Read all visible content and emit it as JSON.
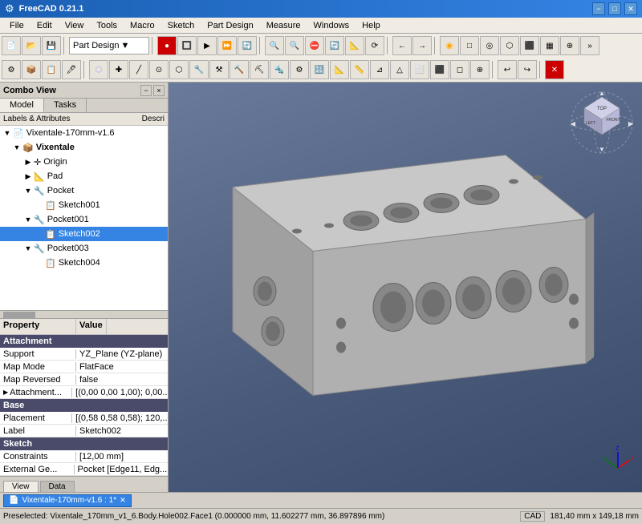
{
  "titlebar": {
    "title": "FreeCAD 0.21.1",
    "icon": "⚙"
  },
  "menubar": {
    "items": [
      "File",
      "Edit",
      "View",
      "Tools",
      "Macro",
      "Sketch",
      "Part Design",
      "Measure",
      "Windows",
      "Help"
    ]
  },
  "toolbar": {
    "workbench_label": "Part Design",
    "workbench_arrow": "▼"
  },
  "combo": {
    "title": "Combo View",
    "minimize_label": "−",
    "close_label": "×",
    "tabs": [
      "Model",
      "Tasks"
    ]
  },
  "tree": {
    "headers": [
      "Labels & Attributes",
      "Descri"
    ],
    "items": [
      {
        "id": "root",
        "label": "Vixentale-170mm-v1.6",
        "level": 0,
        "expanded": true,
        "icon": "📄",
        "arrow": "▼"
      },
      {
        "id": "vixentale",
        "label": "Vixentale",
        "level": 1,
        "expanded": true,
        "icon": "📦",
        "arrow": "▼",
        "selected": false,
        "bold": true
      },
      {
        "id": "origin",
        "label": "Origin",
        "level": 2,
        "expanded": false,
        "icon": "✛",
        "arrow": "▶"
      },
      {
        "id": "pad",
        "label": "Pad",
        "level": 2,
        "expanded": false,
        "icon": "📐",
        "arrow": "▶"
      },
      {
        "id": "pocket",
        "label": "Pocket",
        "level": 2,
        "expanded": true,
        "icon": "🔧",
        "arrow": "▼"
      },
      {
        "id": "sketch001",
        "label": "Sketch001",
        "level": 3,
        "expanded": false,
        "icon": "📋",
        "arrow": ""
      },
      {
        "id": "pocket001",
        "label": "Pocket001",
        "level": 2,
        "expanded": true,
        "icon": "🔧",
        "arrow": "▼"
      },
      {
        "id": "sketch002",
        "label": "Sketch002",
        "level": 3,
        "expanded": false,
        "icon": "📋",
        "arrow": "",
        "selected": true
      },
      {
        "id": "pocket003",
        "label": "Pocket003",
        "level": 2,
        "expanded": true,
        "icon": "🔧",
        "arrow": "▼"
      },
      {
        "id": "sketch004",
        "label": "Sketch004",
        "level": 3,
        "expanded": false,
        "icon": "📋",
        "arrow": ""
      }
    ]
  },
  "properties": {
    "col_property": "Property",
    "col_value": "Value",
    "sections": [
      {
        "name": "Attachment",
        "rows": [
          {
            "name": "Support",
            "value": "YZ_Plane (YZ-plane)"
          },
          {
            "name": "Map Mode",
            "value": "FlatFace"
          },
          {
            "name": "Map Reversed",
            "value": "false"
          },
          {
            "name": "Attachment...",
            "value": "[(0,00 0,00 1,00); 0,00...",
            "arrow": "▶"
          }
        ]
      },
      {
        "name": "Base",
        "rows": [
          {
            "name": "Placement",
            "value": "[(0,58 0,58 0,58); 120,..."
          },
          {
            "name": "Label",
            "value": "Sketch002"
          }
        ]
      },
      {
        "name": "Sketch",
        "rows": [
          {
            "name": "Constraints",
            "value": "[12,00 mm]"
          },
          {
            "name": "External Ge...",
            "value": "Pocket [Edge11, Edg...",
            "arrow": "▶"
          }
        ]
      }
    ]
  },
  "bottom_tabs": [
    {
      "label": "View",
      "active": true
    },
    {
      "label": "Data",
      "active": false
    }
  ],
  "taskbar": {
    "tab_label": "Vixentale-170mm-v1.6 : 1*",
    "tab_icon": "📄"
  },
  "statusbar": {
    "preselected": "Preselected: Vixentale_170mm_v1_6.Body.Hole002.Face1 (0.000000 mm, 11.602277 mm, 36.897896 mm)",
    "cad_label": "CAD",
    "dimensions": "181,40 mm x 149,18 mm"
  },
  "viewport": {
    "bg_gradient_start": "#6a7a9a",
    "bg_gradient_end": "#3a4a6a"
  }
}
